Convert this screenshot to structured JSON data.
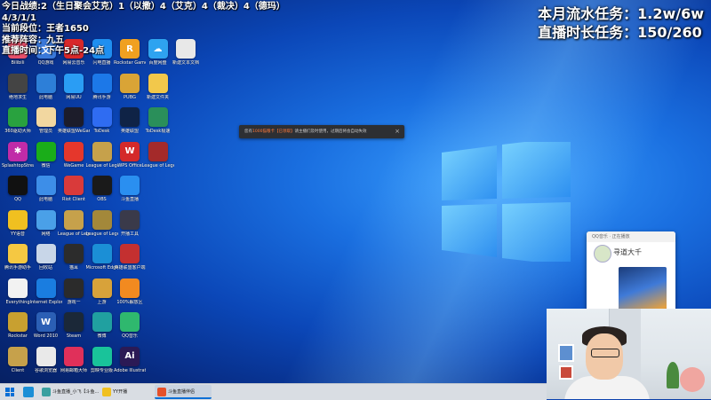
{
  "overlay_left": {
    "line1": "今日战绩:2（生日聚会艾克）1（以撒）4（艾克）4（裁决）4（德玛）",
    "line2": "4/3/1/1",
    "line3": "当前段位：王者1650",
    "line4": "推荐阵容：九五",
    "line5": "直播时间：下午5点-24点"
  },
  "overlay_right": {
    "line1": "本月流水任务：1.2w/6w",
    "line2": "直播时长任务：150/260"
  },
  "toast": {
    "prefix": "您有",
    "highlight": "1000猫粮卡【已领取】",
    "text": "请主播们及时使用，过期后将会自动失效",
    "close": "×"
  },
  "chat_popup": {
    "header": "QQ音乐 · 正在播放",
    "name": "寻道大千"
  },
  "desktop_icons": [
    {
      "label": "Bilibili",
      "color": "#e84f6a",
      "glyph": "▶",
      "col": 0,
      "row": 0
    },
    {
      "label": "QQ游戏",
      "color": "#3a78d9",
      "glyph": "文",
      "col": 1,
      "row": 0
    },
    {
      "label": "网易云音乐",
      "color": "#d8282a",
      "glyph": "♫",
      "col": 2,
      "row": 0
    },
    {
      "label": "闪电直播",
      "color": "#1f8ff0",
      "glyph": "⚡",
      "col": 3,
      "row": 0
    },
    {
      "label": "Rockstar Games",
      "color": "#f0a020",
      "glyph": "R",
      "col": 4,
      "row": 0
    },
    {
      "label": "百度网盘",
      "color": "#2ea3f0",
      "glyph": "☁",
      "col": 4,
      "row": 0
    },
    {
      "label": "新建文本文档",
      "color": "#e8e8e8",
      "glyph": "",
      "col": 5,
      "row": 0
    },
    {
      "label": "绝地求生",
      "color": "#444",
      "glyph": "",
      "col": 0,
      "row": 1
    },
    {
      "label": "此电脑",
      "color": "#2d7fd8",
      "glyph": "",
      "col": 1,
      "row": 1
    },
    {
      "label": "网易UU",
      "color": "#2a9df4",
      "glyph": "",
      "col": 2,
      "row": 1
    },
    {
      "label": "腾讯手游",
      "color": "#1c78e8",
      "glyph": "",
      "col": 3,
      "row": 1
    },
    {
      "label": "PUBG",
      "color": "#d9a436",
      "glyph": "",
      "col": 4,
      "row": 1
    },
    {
      "label": "新建文件夹",
      "color": "#f2c84b",
      "glyph": "",
      "col": 5,
      "row": 1
    },
    {
      "label": "360驱动大师",
      "color": "#29a23f",
      "glyph": "",
      "col": 0,
      "row": 2
    },
    {
      "label": "管理员",
      "color": "#f2d7a0",
      "glyph": "",
      "col": 1,
      "row": 2
    },
    {
      "label": "英雄联盟WeGame版",
      "color": "#1c1c2a",
      "glyph": "",
      "col": 2,
      "row": 2
    },
    {
      "label": "ToDesk",
      "color": "#2f6cf2",
      "glyph": "",
      "col": 3,
      "row": 2
    },
    {
      "label": "英雄联盟",
      "color": "#0f2346",
      "glyph": "",
      "col": 4,
      "row": 2
    },
    {
      "label": "ToDesk极速",
      "color": "#2a8f5a",
      "glyph": "",
      "col": 5,
      "row": 2
    },
    {
      "label": "SplashtopStreamer",
      "color": "#c02ba8",
      "glyph": "✱",
      "col": 0,
      "row": 3
    },
    {
      "label": "微信",
      "color": "#1aad19",
      "glyph": "",
      "col": 1,
      "row": 3
    },
    {
      "label": "WeGame",
      "color": "#e5372c",
      "glyph": "",
      "col": 2,
      "row": 3
    },
    {
      "label": "League of Legends",
      "color": "#c6a14b",
      "glyph": "",
      "col": 3,
      "row": 3
    },
    {
      "label": "WPS Office",
      "color": "#d42a2a",
      "glyph": "W",
      "col": 4,
      "row": 3
    },
    {
      "label": "League of Legends",
      "color": "#a42a2a",
      "glyph": "",
      "col": 5,
      "row": 3
    },
    {
      "label": "QQ",
      "color": "#111",
      "glyph": "",
      "col": 0,
      "row": 4
    },
    {
      "label": "此电脑",
      "color": "#3d8ee8",
      "glyph": "",
      "col": 1,
      "row": 4
    },
    {
      "label": "Riot Client",
      "color": "#d93a3a",
      "glyph": "",
      "col": 2,
      "row": 4
    },
    {
      "label": "OBS",
      "color": "#1a1a1a",
      "glyph": "",
      "col": 3,
      "row": 4
    },
    {
      "label": "斗鱼直播",
      "color": "#2a8ff0",
      "glyph": "",
      "col": 4,
      "row": 4
    },
    {
      "label": "YY语音",
      "color": "#f0c020",
      "glyph": "",
      "col": 0,
      "row": 5
    },
    {
      "label": "网络",
      "color": "#4aa0e8",
      "glyph": "",
      "col": 1,
      "row": 5
    },
    {
      "label": "League of Legends",
      "color": "#c6a14b",
      "glyph": "",
      "col": 2,
      "row": 5
    },
    {
      "label": "League of Legends",
      "color": "#a3883a",
      "glyph": "",
      "col": 3,
      "row": 5
    },
    {
      "label": "开播工具",
      "color": "#3a3a4a",
      "glyph": "",
      "col": 4,
      "row": 5
    },
    {
      "label": "腾讯手游助手",
      "color": "#f5c842",
      "glyph": "",
      "col": 0,
      "row": 6
    },
    {
      "label": "回收站",
      "color": "#c8d6e8",
      "glyph": "",
      "col": 1,
      "row": 6
    },
    {
      "label": "猫耳",
      "color": "#2c2c2c",
      "glyph": "",
      "col": 2,
      "row": 6
    },
    {
      "label": "Microsoft Edge",
      "color": "#1b8fd6",
      "glyph": "",
      "col": 3,
      "row": 6
    },
    {
      "label": "英雄联盟客户端",
      "color": "#c43030",
      "glyph": "",
      "col": 4,
      "row": 6
    },
    {
      "label": "Everything",
      "color": "#f2f2f2",
      "glyph": "",
      "col": 0,
      "row": 7
    },
    {
      "label": "Internet Explorer",
      "color": "#1a7de0",
      "glyph": "",
      "col": 1,
      "row": 7
    },
    {
      "label": "游戏一",
      "color": "#2b2b2b",
      "glyph": "",
      "col": 2,
      "row": 7
    },
    {
      "label": "上游",
      "color": "#d8a23a",
      "glyph": "",
      "col": 3,
      "row": 7
    },
    {
      "label": "100%解放区",
      "color": "#f28a20",
      "glyph": "",
      "col": 4,
      "row": 7
    },
    {
      "label": "Rockstar",
      "color": "#c8a030",
      "glyph": "",
      "col": 0,
      "row": 8
    },
    {
      "label": "Word 2010",
      "color": "#2b5fb5",
      "glyph": "W",
      "col": 1,
      "row": 8
    },
    {
      "label": "Steam",
      "color": "#1b2838",
      "glyph": "",
      "col": 2,
      "row": 8
    },
    {
      "label": "微博",
      "color": "#20a0a0",
      "glyph": "",
      "col": 3,
      "row": 8
    },
    {
      "label": "QQ音乐",
      "color": "#2fb86e",
      "glyph": "",
      "col": 4,
      "row": 8
    },
    {
      "label": "Client",
      "color": "#c6a14b",
      "glyph": "",
      "col": 0,
      "row": 9
    },
    {
      "label": "谷歌浏览器",
      "color": "#e9e9e9",
      "glyph": "",
      "col": 1,
      "row": 9
    },
    {
      "label": "网易邮箱大师",
      "color": "#e0305a",
      "glyph": "",
      "col": 2,
      "row": 9
    },
    {
      "label": "剪映专业版",
      "color": "#19c39a",
      "glyph": "",
      "col": 3,
      "row": 9
    },
    {
      "label": "Adobe Illustrator",
      "color": "#2b1a55",
      "glyph": "Ai",
      "col": 4,
      "row": 9
    }
  ],
  "taskbar": {
    "tasks": [
      {
        "label": "斗鱼直播_小飞【斗鱼...",
        "color": "#3aa0a0",
        "active": false
      },
      {
        "label": "YY开播",
        "color": "#f0c020",
        "active": false
      },
      {
        "label": "斗鱼直播伴侣",
        "color": "#e5502a",
        "active": true
      }
    ]
  }
}
